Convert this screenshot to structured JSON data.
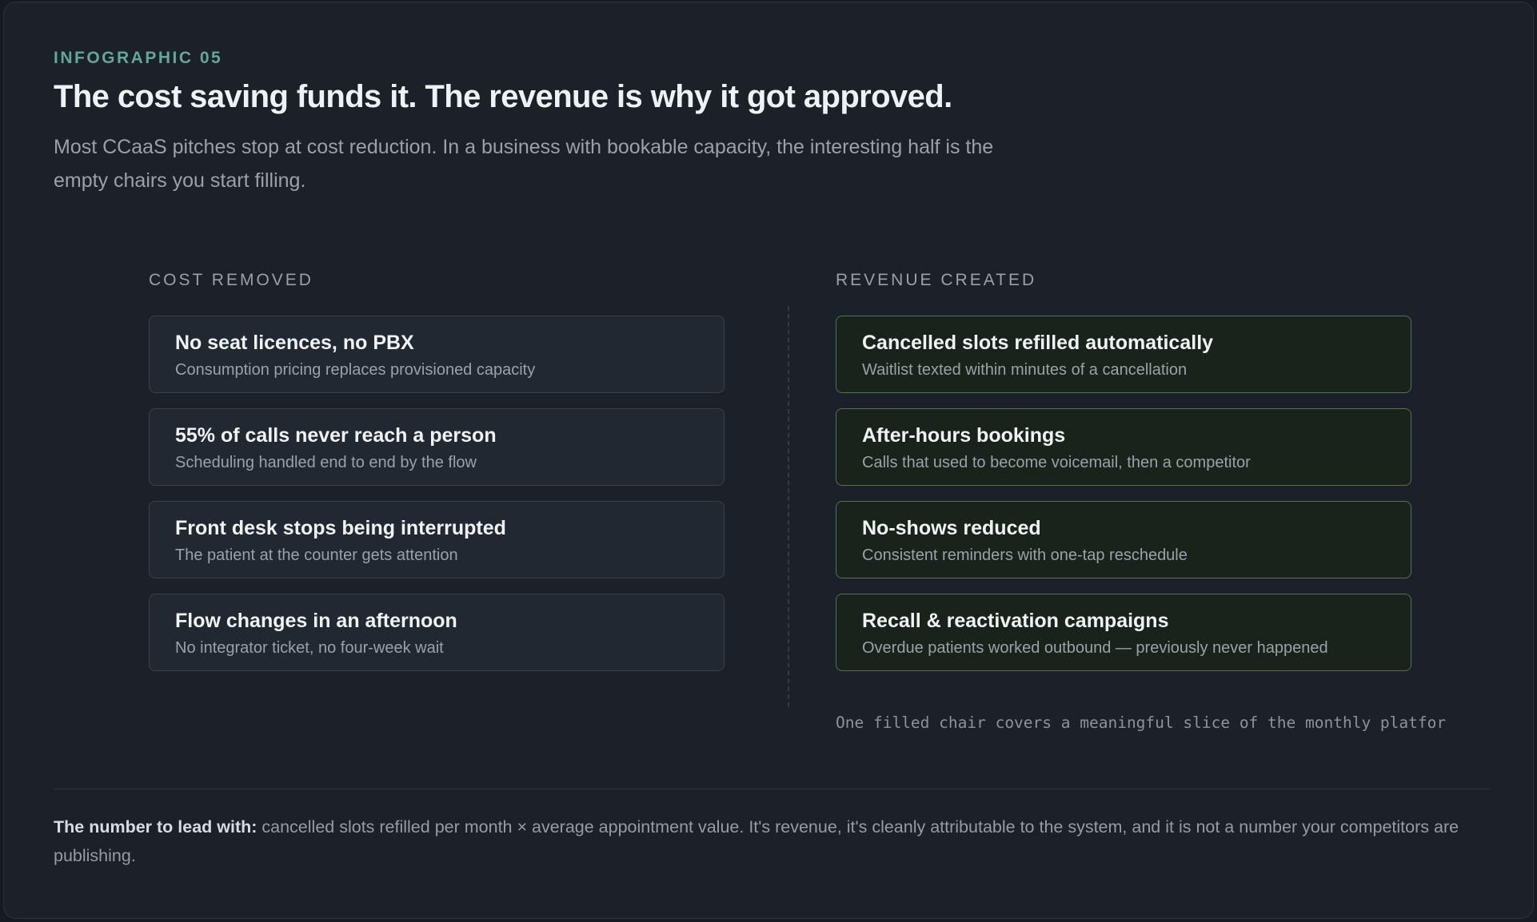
{
  "eyebrow": "INFOGRAPHIC 05",
  "title": "The cost saving funds it. The revenue is why it got approved.",
  "subtitle": "Most CCaaS pitches stop at cost reduction. In a business with bookable capacity, the interesting half is the empty chairs you start filling.",
  "cost": {
    "heading": "COST REMOVED",
    "items": [
      {
        "title": "No seat licences, no PBX",
        "sub": "Consumption pricing replaces provisioned capacity"
      },
      {
        "title": "55% of calls never reach a person",
        "sub": "Scheduling handled end to end by the flow"
      },
      {
        "title": "Front desk stops being interrupted",
        "sub": "The patient at the counter gets attention"
      },
      {
        "title": "Flow changes in an afternoon",
        "sub": "No integrator ticket, no four-week wait"
      }
    ]
  },
  "revenue": {
    "heading": "REVENUE CREATED",
    "items": [
      {
        "title": "Cancelled slots refilled automatically",
        "sub": "Waitlist texted within minutes of a cancellation"
      },
      {
        "title": "After-hours bookings",
        "sub": "Calls that used to become voicemail, then a competitor"
      },
      {
        "title": "No-shows reduced",
        "sub": "Consistent reminders with one-tap reschedule"
      },
      {
        "title": "Recall & reactivation campaigns",
        "sub": "Overdue patients worked outbound — previously never happened"
      }
    ],
    "note": "One filled chair covers a meaningful slice of the monthly platfor"
  },
  "footer": {
    "lead": "The number to lead with:",
    "text": " cancelled slots refilled per month × average appointment value. It's revenue, it's cleanly attributable to the system, and it is not a number your competitors are publishing."
  },
  "colors": {
    "accent": "#5fa89a",
    "background": "#1b2029",
    "cost_card": "#222832",
    "revenue_card": "#19231b",
    "revenue_border": "#4c7651"
  }
}
